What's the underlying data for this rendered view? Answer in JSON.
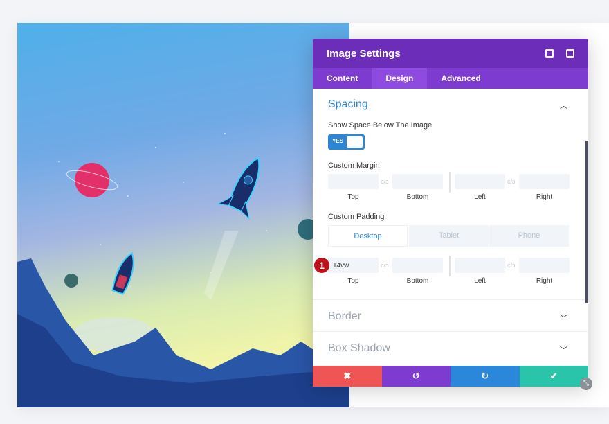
{
  "panel": {
    "title": "Image Settings",
    "icons": [
      "focus-icon",
      "sidebar-layout-icon"
    ],
    "tabs": [
      {
        "label": "Content"
      },
      {
        "label": "Design"
      },
      {
        "label": "Advanced"
      }
    ],
    "active_tab": "Design",
    "spacing": {
      "title": "Spacing",
      "show_space_label": "Show Space Below The Image",
      "toggle_label": "YES",
      "margin_label": "Custom Margin",
      "padding_label": "Custom Padding",
      "devices": [
        "Desktop",
        "Tablet",
        "Phone"
      ],
      "fields": [
        "Top",
        "Bottom",
        "Left",
        "Right"
      ],
      "padding_top_value": "14vw",
      "link_glyph": "⛓"
    },
    "badge": "1",
    "sections": [
      {
        "title": "Border"
      },
      {
        "title": "Box Shadow"
      }
    ],
    "footer": {
      "cancel": "✖",
      "undo": "↺",
      "redo": "↻",
      "save": "✔"
    },
    "colors": {
      "header": "#6c2eb9",
      "tabs": "#7d3bd0",
      "accent": "#2e85d3",
      "cancel": "#ef5555",
      "undo": "#7e3bd0",
      "redo": "#2b87da",
      "save": "#29c4a9"
    }
  }
}
